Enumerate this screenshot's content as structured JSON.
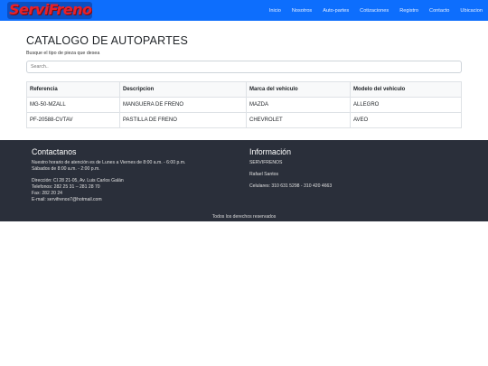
{
  "brand": {
    "logo_text": "ServiFrenos"
  },
  "nav": [
    "Inicio",
    "Nosotros",
    "Auto-partes",
    "Cotizaciones",
    "Registro",
    "Contacto",
    "Ubicacion"
  ],
  "main": {
    "title": "CATALOGO DE AUTOPARTES",
    "subtitle": "Busque el tipo de pieza que desea",
    "search_placeholder": "Search.."
  },
  "table": {
    "headers": [
      "Referencia",
      "Descripcion",
      "Marca del vehiculo",
      "Modelo del vehiculo"
    ],
    "rows": [
      [
        "MG-50-MZALL",
        "MANGUERA DE FRENO",
        "MAZDA",
        "ALLEGRO"
      ],
      [
        "PF-20588-CVTAV",
        "PASTILLA DE FRENO",
        "CHEVROLET",
        "AVEO"
      ]
    ]
  },
  "footer": {
    "contact": {
      "title": "Contactanos",
      "schedule_1": "Nuestro horario de atención es de Lunes a Viernes de 8:00 a.m. - 6:00 p.m.",
      "schedule_2": "Sábados de 8:00 a.m. - 2:00 p.m.",
      "address": "Dirección: Cl 28 21-05, Av. Luis Carlos Galán",
      "phones": "Telefonos: 282 25 31 – 281 28 70",
      "fax": "Fax: 282 20 24",
      "email": "E-mail: servifrenos7@hotmail.com"
    },
    "info": {
      "title": "Información",
      "company": "SERVIFRENOS",
      "person": "Rafael Santos",
      "cellphones": "Celulares: 310 631 5298 - 310 420 4663"
    },
    "copyright": "Todos los derechos reservados"
  },
  "colors": {
    "navbar": "#0d6efd",
    "footer": "#2a2f3a",
    "logo": "#e8212a"
  }
}
